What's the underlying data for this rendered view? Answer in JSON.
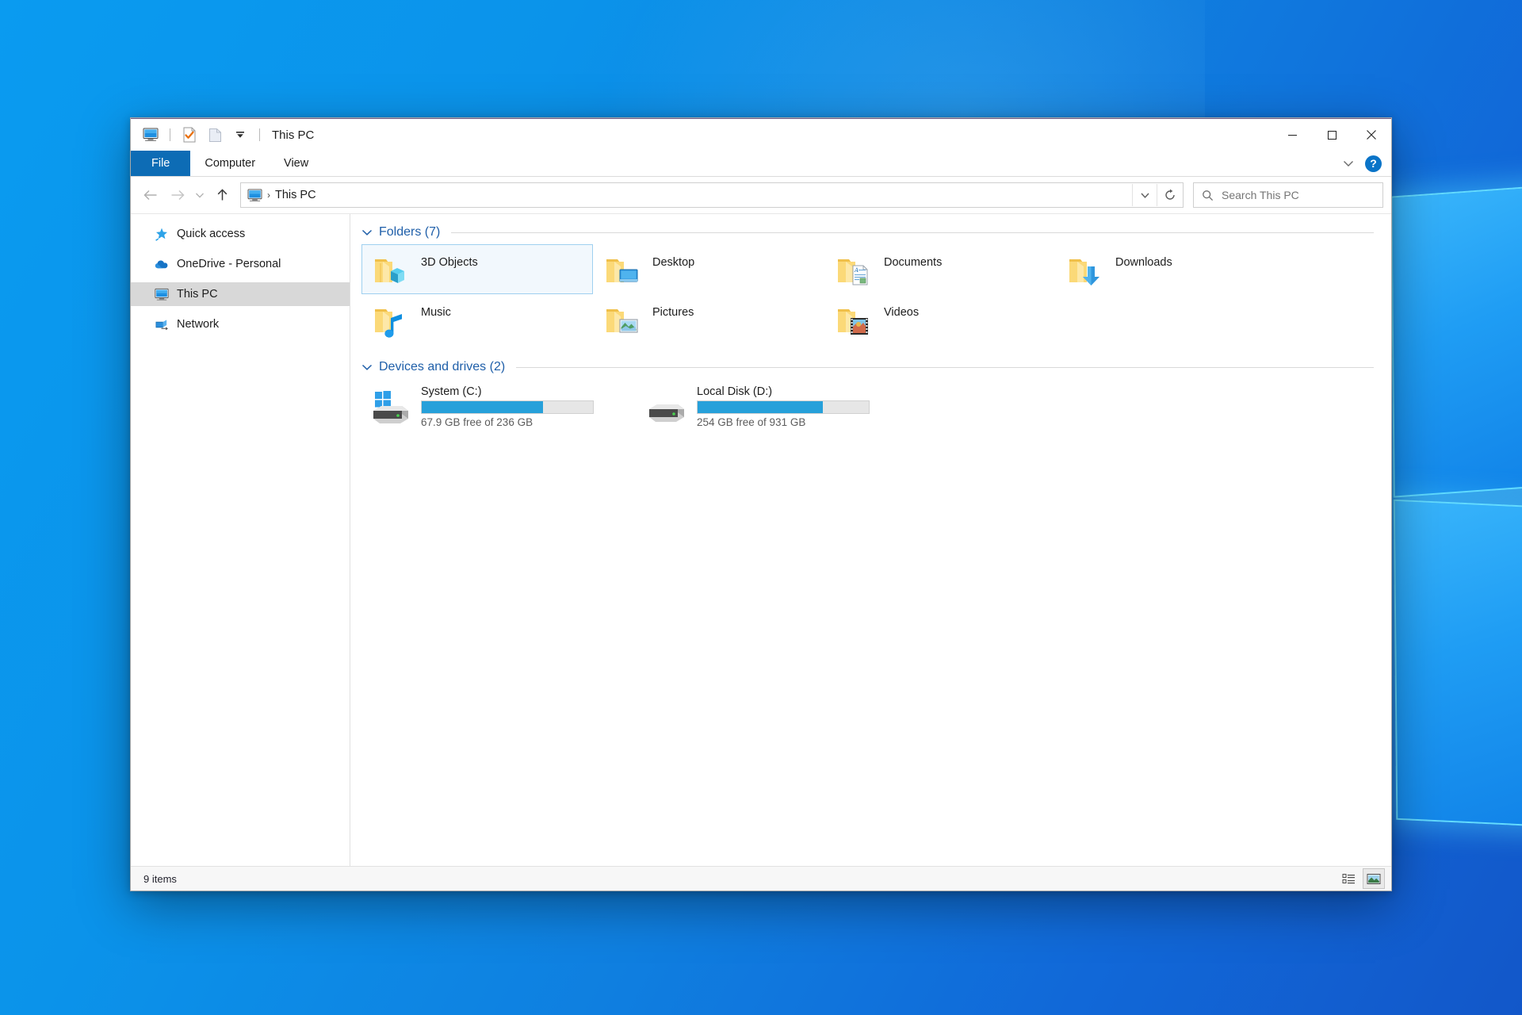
{
  "window": {
    "title": "This PC",
    "quick_access_icons": [
      "this-pc-icon",
      "properties-icon",
      "new-folder-icon",
      "customize-dropdown-icon"
    ],
    "controls": {
      "minimize": "—",
      "maximize": "□",
      "close": "✕"
    }
  },
  "ribbon": {
    "tabs": [
      {
        "label": "File",
        "active": true
      },
      {
        "label": "Computer",
        "active": false
      },
      {
        "label": "View",
        "active": false
      }
    ],
    "expand_icon": "chevron-down-icon",
    "help_label": "?"
  },
  "address_bar": {
    "back_icon": "back-arrow-icon",
    "forward_icon": "forward-arrow-icon",
    "recent_icon": "chevron-down-icon",
    "up_icon": "up-arrow-icon",
    "crumb_icon": "this-pc-icon",
    "crumb_text": "This PC",
    "separator": "›",
    "dropdown_icon": "chevron-down-icon",
    "refresh_icon": "refresh-icon"
  },
  "search": {
    "placeholder": "Search This PC",
    "value": "",
    "icon": "search-icon"
  },
  "sidebar": {
    "items": [
      {
        "label": "Quick access",
        "icon": "pin-star-icon",
        "selected": false
      },
      {
        "label": "OneDrive - Personal",
        "icon": "cloud-icon",
        "selected": false
      },
      {
        "label": "This PC",
        "icon": "this-pc-icon",
        "selected": true
      },
      {
        "label": "Network",
        "icon": "network-icon",
        "selected": false
      }
    ]
  },
  "main": {
    "folders_group": {
      "title": "Folders (7)",
      "collapse_icon": "chevron-down-icon",
      "items": [
        {
          "label": "3D Objects",
          "emblem": "cube-icon",
          "selected": true
        },
        {
          "label": "Desktop",
          "emblem": "monitor-icon",
          "selected": false
        },
        {
          "label": "Documents",
          "emblem": "document-icon",
          "selected": false
        },
        {
          "label": "Downloads",
          "emblem": "down-arrow-icon",
          "selected": false
        },
        {
          "label": "Music",
          "emblem": "music-note-icon",
          "selected": false
        },
        {
          "label": "Pictures",
          "emblem": "picture-icon",
          "selected": false
        },
        {
          "label": "Videos",
          "emblem": "film-strip-icon",
          "selected": false
        }
      ]
    },
    "drives_group": {
      "title": "Devices and drives (2)",
      "collapse_icon": "chevron-down-icon",
      "items": [
        {
          "name": "System (C:)",
          "free_text": "67.9 GB free of 236 GB",
          "used_percent": 71,
          "icon": "windows-drive-icon"
        },
        {
          "name": "Local Disk (D:)",
          "free_text": "254 GB free of 931 GB",
          "used_percent": 73,
          "icon": "hard-drive-icon"
        }
      ]
    }
  },
  "status_bar": {
    "item_count": "9 items",
    "views": [
      {
        "name": "details-view",
        "active": false
      },
      {
        "name": "large-icons-view",
        "active": true
      }
    ]
  },
  "colors": {
    "accent": "#0d6cb5",
    "bar_fill": "#26a0da",
    "group_title": "#1f5fa9",
    "selection": "#f2f8fd",
    "desktop_blue": "#0b93ea"
  }
}
